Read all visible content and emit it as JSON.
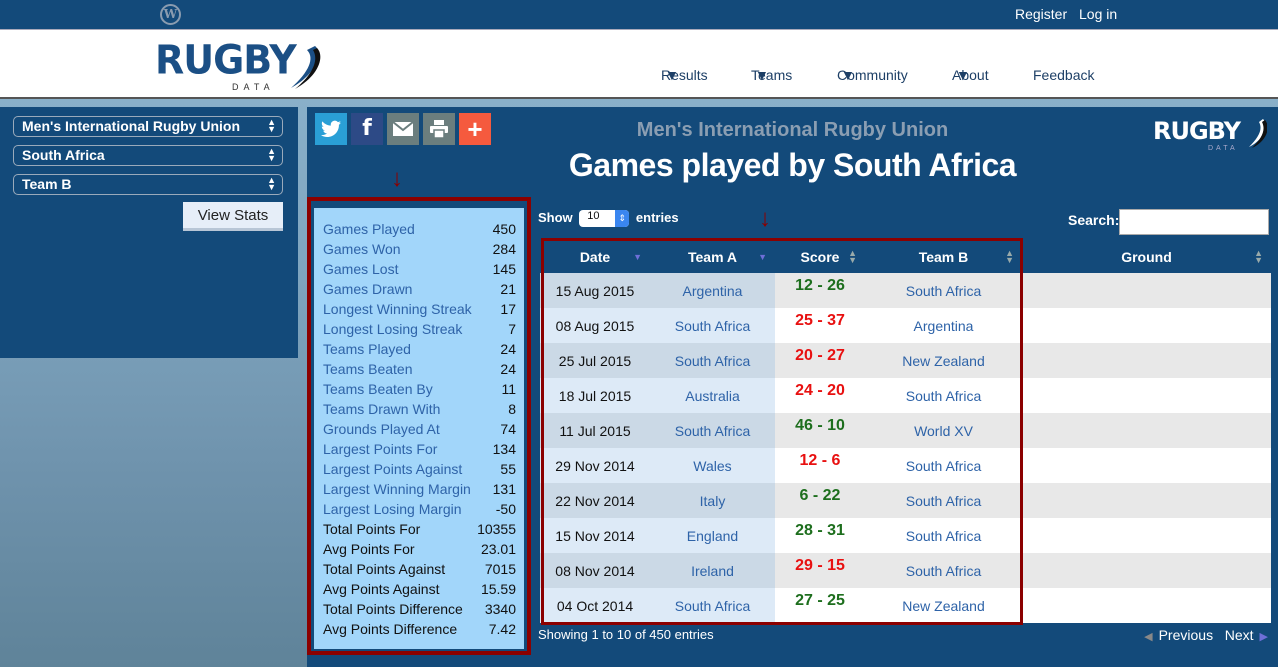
{
  "topbar": {
    "wordpress_icon": "wordpress-icon",
    "register": "Register",
    "login": "Log in"
  },
  "header": {
    "logo_word": "RUGBY",
    "logo_sub": "DATA",
    "nav": [
      {
        "label": "Results",
        "dropdown": true
      },
      {
        "label": "Teams",
        "dropdown": true
      },
      {
        "label": "Community",
        "dropdown": true
      },
      {
        "label": "About",
        "dropdown": true
      },
      {
        "label": "Feedback",
        "dropdown": false
      }
    ]
  },
  "sidebar": {
    "competition": "Men's International Rugby Union",
    "team": "South Africa",
    "team_role": "Team B",
    "button": "View Stats"
  },
  "main": {
    "share_icons": [
      "twitter-icon",
      "facebook-icon",
      "email-icon",
      "print-icon",
      "plus-icon"
    ],
    "subtitle": "Men's International Rugby Union",
    "title": "Games played by South Africa",
    "logo_word": "RUGBY",
    "logo_sub": "DATA"
  },
  "stats": [
    {
      "label": "Games Played",
      "value": "450",
      "link": true
    },
    {
      "label": "Games Won",
      "value": "284",
      "link": true
    },
    {
      "label": "Games Lost",
      "value": "145",
      "link": true
    },
    {
      "label": "Games Drawn",
      "value": "21",
      "link": true
    },
    {
      "label": "Longest Winning Streak",
      "value": "17",
      "link": true
    },
    {
      "label": "Longest Losing Streak",
      "value": "7",
      "link": true
    },
    {
      "label": "Teams Played",
      "value": "24",
      "link": true
    },
    {
      "label": "Teams Beaten",
      "value": "24",
      "link": true
    },
    {
      "label": "Teams Beaten By",
      "value": "11",
      "link": true
    },
    {
      "label": "Teams Drawn With",
      "value": "8",
      "link": true
    },
    {
      "label": "Grounds Played At",
      "value": "74",
      "link": true
    },
    {
      "label": "Largest Points For",
      "value": "134",
      "link": true
    },
    {
      "label": "Largest Points Against",
      "value": "55",
      "link": true
    },
    {
      "label": "Largest Winning Margin",
      "value": "131",
      "link": true
    },
    {
      "label": "Largest Losing Margin",
      "value": "-50",
      "link": true
    },
    {
      "label": "Total Points For",
      "value": "10355",
      "link": false
    },
    {
      "label": "Avg Points For",
      "value": "23.01",
      "link": false
    },
    {
      "label": "Total Points Against",
      "value": "7015",
      "link": false
    },
    {
      "label": "Avg Points Against",
      "value": "15.59",
      "link": false
    },
    {
      "label": "Total Points Difference",
      "value": "3340",
      "link": false
    },
    {
      "label": "Avg Points Difference",
      "value": "7.42",
      "link": false
    }
  ],
  "table": {
    "show_label": "Show",
    "page_length": "10",
    "entries_label": "entries",
    "search_label": "Search:",
    "search_value": "",
    "columns": [
      "Date",
      "Team A",
      "Score",
      "Team B",
      "Ground"
    ],
    "rows": [
      {
        "date": "15 Aug 2015",
        "team_a": "Argentina",
        "score": "12 - 26",
        "result": "win",
        "team_b": "South Africa",
        "ground": ""
      },
      {
        "date": "08 Aug 2015",
        "team_a": "South Africa",
        "score": "25 - 37",
        "result": "loss",
        "team_b": "Argentina",
        "ground": ""
      },
      {
        "date": "25 Jul 2015",
        "team_a": "South Africa",
        "score": "20 - 27",
        "result": "loss",
        "team_b": "New Zealand",
        "ground": ""
      },
      {
        "date": "18 Jul 2015",
        "team_a": "Australia",
        "score": "24 - 20",
        "result": "loss",
        "team_b": "South Africa",
        "ground": ""
      },
      {
        "date": "11 Jul 2015",
        "team_a": "South Africa",
        "score": "46 - 10",
        "result": "win",
        "team_b": "World XV",
        "ground": ""
      },
      {
        "date": "29 Nov 2014",
        "team_a": "Wales",
        "score": "12 - 6",
        "result": "loss",
        "team_b": "South Africa",
        "ground": ""
      },
      {
        "date": "22 Nov 2014",
        "team_a": "Italy",
        "score": "6 - 22",
        "result": "win",
        "team_b": "South Africa",
        "ground": ""
      },
      {
        "date": "15 Nov 2014",
        "team_a": "England",
        "score": "28 - 31",
        "result": "win",
        "team_b": "South Africa",
        "ground": ""
      },
      {
        "date": "08 Nov 2014",
        "team_a": "Ireland",
        "score": "29 - 15",
        "result": "loss",
        "team_b": "South Africa",
        "ground": ""
      },
      {
        "date": "04 Oct 2014",
        "team_a": "South Africa",
        "score": "27 - 25",
        "result": "win",
        "team_b": "New Zealand",
        "ground": ""
      }
    ],
    "info": "Showing 1 to 10 of 450 entries",
    "previous": "Previous",
    "next": "Next"
  },
  "colors": {
    "brand_blue": "#134a7a",
    "win": "#1d6e1d",
    "loss": "#e81010",
    "highlight_border": "#8b0000"
  }
}
